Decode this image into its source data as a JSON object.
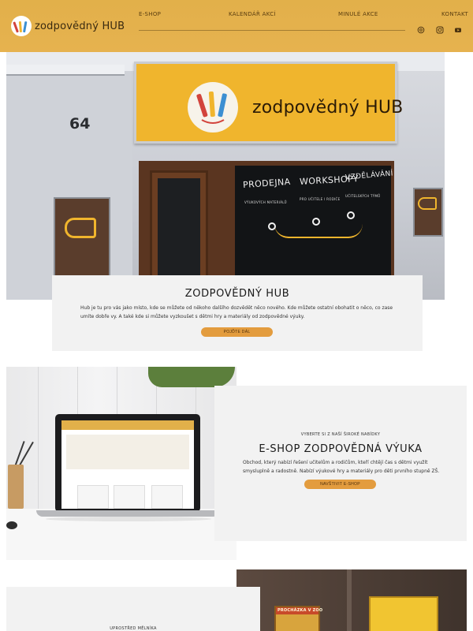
{
  "header": {
    "logo_text": "zodpovědný HUB",
    "nav": [
      {
        "label": "E-SHOP"
      },
      {
        "label": "KALENDÁŘ AKCÍ"
      },
      {
        "label": "MINULÉ AKCE"
      },
      {
        "label": "KONTAKT"
      }
    ],
    "social_icons": [
      "threads-icon",
      "instagram-icon",
      "youtube-icon"
    ]
  },
  "hero": {
    "house_number": "64",
    "sign_text": "zodpovědný HUB",
    "window_words": [
      "PRODEJNA",
      "WORKSHOPY",
      "VZDĚLÁVÁNÍ"
    ],
    "window_sub": [
      "VÝUKOVÝCH MATERIÁLŮ",
      "PRO UČITELE I RODIČE",
      "UČITELSKÝCH TÝMŮ"
    ],
    "title": "ZODPOVĚDNÝ HUB",
    "text": "Hub je tu pro vás jako místo, kde se můžete od někoho dalšího dozvědět něco nového. Kde můžete ostatní obohatit o něco, co zase umíte dobře vy. A také kde si můžete vyzkoušet s dětmi hry a materiály od zodpovědné výuky.",
    "button": "POJĎTE DÁL"
  },
  "eshop": {
    "eyebrow": "VYBERTE SI Z NAŠÍ ŠIROKÉ NABÍDKY",
    "title": "E-SHOP ZODPOVĚDNÁ VÝUKA",
    "text": "Obchod, který nabízí řešení učitelům a rodičům, kteří chtějí čas s dětmi využít smysluplně a radostně. Nabízí výukové hry a materiály pro děti prvního stupně ZŠ.",
    "button": "NAVŠTIVIT E-SHOP"
  },
  "next_section": {
    "eyebrow": "UPROSTŘED MĚLNÍKA",
    "box_label": "PROCHÁZKA V ZOO"
  },
  "colors": {
    "header": "#e2b04a",
    "accent_button": "#e39c3e",
    "card_bg": "#f2f2f2"
  }
}
